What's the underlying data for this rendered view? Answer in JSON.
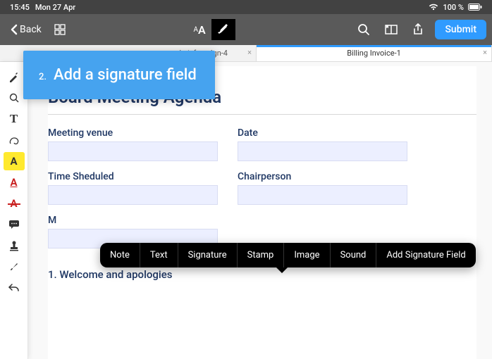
{
  "status": {
    "time": "15:45",
    "date": "Mon 27 Apr",
    "battery": "100 %"
  },
  "toolbar": {
    "back_label": "Back",
    "submit_label": "Submit"
  },
  "tabs": [
    {
      "label": "ket_for_sign-4",
      "active": false
    },
    {
      "label": "Billing Invoice-1",
      "active": true
    }
  ],
  "callout": {
    "step": "2.",
    "text": "Add a signature field"
  },
  "document": {
    "title": "Board Meeting Agenda",
    "fields": {
      "venue_label": "Meeting venue",
      "date_label": "Date",
      "time_label": "Time Sheduled",
      "chair_label": "Chairperson",
      "minute_label": "M"
    },
    "agenda_item_1": "1.  Welcome and apologies"
  },
  "context_menu": {
    "items": [
      "Note",
      "Text",
      "Signature",
      "Stamp",
      "Image",
      "Sound",
      "Add Signature Field"
    ]
  },
  "sidebar_tools": [
    "pen-icon",
    "magnifier-icon",
    "text-t-icon",
    "lasso-icon",
    "highlight-a-icon",
    "underline-a-icon",
    "strike-a-icon",
    "comment-icon",
    "stamp-icon",
    "brush-icon",
    "undo-icon"
  ]
}
